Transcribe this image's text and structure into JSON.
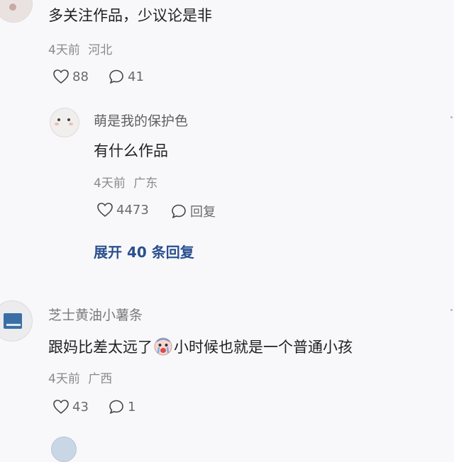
{
  "comments": [
    {
      "text": "多关注作品，少议论是非",
      "time": "4天前",
      "region": "河北",
      "likes": "88",
      "replies": "41",
      "reply": {
        "nickname": "萌是我的保护色",
        "text": "有什么作品",
        "time": "4天前",
        "region": "广东",
        "likes": "4473",
        "reply_label": "回复"
      },
      "expand_label": "展开 40 条回复"
    },
    {
      "nickname": "芝士黄油小薯条",
      "text_before": "跟妈比差太远了",
      "emoji": "crying-face-emoji",
      "text_after": "小时候也就是一个普通小孩",
      "time": "4天前",
      "region": "广西",
      "likes": "43",
      "replies": "1"
    }
  ],
  "icons": {
    "like": "heart-outline-icon",
    "comment": "speech-bubble-icon"
  },
  "colors": {
    "background": "#f8f8fa",
    "text": "#1f1f1f",
    "meta": "#8a8a8a",
    "link": "#2a4f8f",
    "book_avatar": "#3a6fa5"
  }
}
